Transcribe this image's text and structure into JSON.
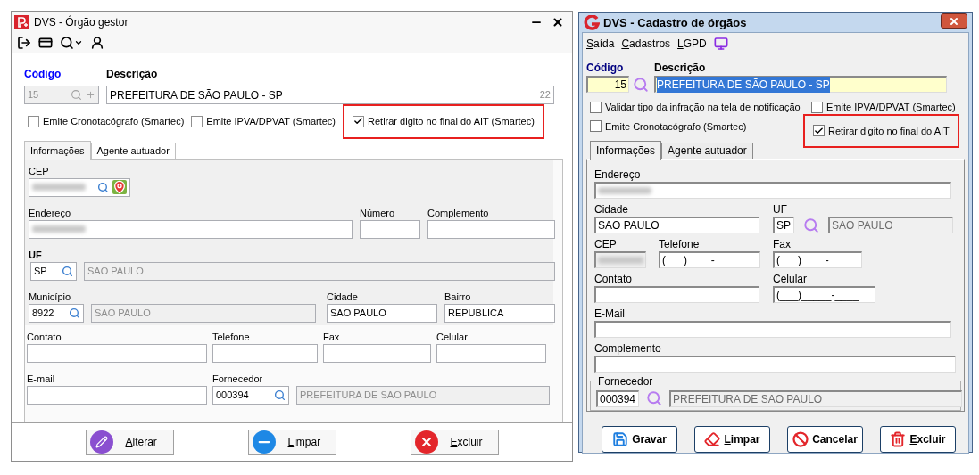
{
  "left": {
    "title": "DVS - Órgão gestor",
    "code_label": "Código",
    "desc_label": "Descrição",
    "code": {
      "value": "15",
      "disabled": true
    },
    "description": {
      "value": "PREFEITURA DE SÃO PAULO - SP",
      "count": "22"
    },
    "checkboxes": [
      {
        "label": "Emite Cronotacógrafo (Smartec)",
        "checked": false,
        "highlighted": false
      },
      {
        "label": "Emite IPVA/DPVAT (Smartec)",
        "checked": false,
        "highlighted": false
      },
      {
        "label": "Retirar digito no final do AIT (Smartec)",
        "checked": true,
        "highlighted": true
      }
    ],
    "tabs": [
      {
        "label": "Informações",
        "selected": true
      },
      {
        "label": "Agente autuador",
        "selected": false
      }
    ],
    "cep": {
      "label": "CEP",
      "redacted": true
    },
    "endereco": {
      "label": "Endereço",
      "redacted": true
    },
    "numero": {
      "label": "Número"
    },
    "complemento": {
      "label": "Complemento"
    },
    "uf": {
      "label": "UF",
      "code": "SP",
      "name": "SAO PAULO"
    },
    "municipio": {
      "label": "Município",
      "code": "8922",
      "name": "SAO PAULO"
    },
    "cidade": {
      "label": "Cidade",
      "value": "SAO PAULO"
    },
    "bairro": {
      "label": "Bairro",
      "value": "REPUBLICA"
    },
    "contato": {
      "label": "Contato"
    },
    "telefone": {
      "label": "Telefone"
    },
    "fax": {
      "label": "Fax"
    },
    "celular": {
      "label": "Celular"
    },
    "email": {
      "label": "E-mail"
    },
    "fornecedor": {
      "label": "Fornecedor",
      "code": "000394",
      "name": "PREFEITURA DE SAO PAULO"
    },
    "buttons": [
      {
        "label": "Alterar",
        "kind": "edit",
        "mnemonic": true
      },
      {
        "label": "Limpar",
        "kind": "minus",
        "mnemonic": true
      },
      {
        "label": "Excluir",
        "kind": "close",
        "mnemonic": true
      }
    ]
  },
  "right": {
    "title": "DVS - Cadastro de órgãos",
    "menu": [
      {
        "label": "Saída",
        "mnemonic": true
      },
      {
        "label": "Cadastros",
        "mnemonic": true
      },
      {
        "label": "LGPD",
        "mnemonic": true
      }
    ],
    "code_label": "Código",
    "desc_label": "Descrição",
    "code": {
      "value": "15"
    },
    "description": {
      "value": "PREFEITURA DE SÃO PAULO - SP",
      "text_selected": true
    },
    "checkboxes": [
      {
        "label": "Validar tipo da infração na tela de notificação",
        "checked": false,
        "highlighted": false
      },
      {
        "label": "Emite IPVA/DPVAT (Smartec)",
        "checked": false,
        "highlighted": false
      },
      {
        "label": "Emite Cronotacógrafo (Smartec)",
        "checked": false,
        "highlighted": false
      },
      {
        "label": "Retirar digito no final do AIT",
        "checked": true,
        "highlighted": true
      }
    ],
    "tabs": [
      {
        "label": "Informações",
        "selected": true
      },
      {
        "label": "Agente autuador",
        "selected": false
      }
    ],
    "endereco": {
      "label": "Endereço",
      "redacted": true
    },
    "cidade": {
      "label": "Cidade",
      "value": "SAO PAULO"
    },
    "uf": {
      "label": "UF",
      "code": "SP",
      "name": "SAO PAULO"
    },
    "cep": {
      "label": "CEP",
      "redacted": true,
      "disabled": true
    },
    "telefone": {
      "label": "Telefone",
      "value": "(___)____-____"
    },
    "fax": {
      "label": "Fax",
      "value": "(___)____-____"
    },
    "contato": {
      "label": "Contato"
    },
    "celular": {
      "label": "Celular",
      "value": "(___)_____-____"
    },
    "email": {
      "label": "E-Mail"
    },
    "complemento": {
      "label": "Complemento"
    },
    "fornecedor": {
      "label": "Fornecedor",
      "code": "000394",
      "name": "PREFEITURA DE SAO PAULO"
    },
    "buttons": [
      {
        "label": "Gravar",
        "kind": "save",
        "mnemonic": false
      },
      {
        "label": "Limpar",
        "kind": "eraser",
        "mnemonic": true
      },
      {
        "label": "Cancelar",
        "kind": "cancel",
        "mnemonic": false
      },
      {
        "label": "Excluir",
        "kind": "trash",
        "mnemonic": true
      }
    ]
  }
}
